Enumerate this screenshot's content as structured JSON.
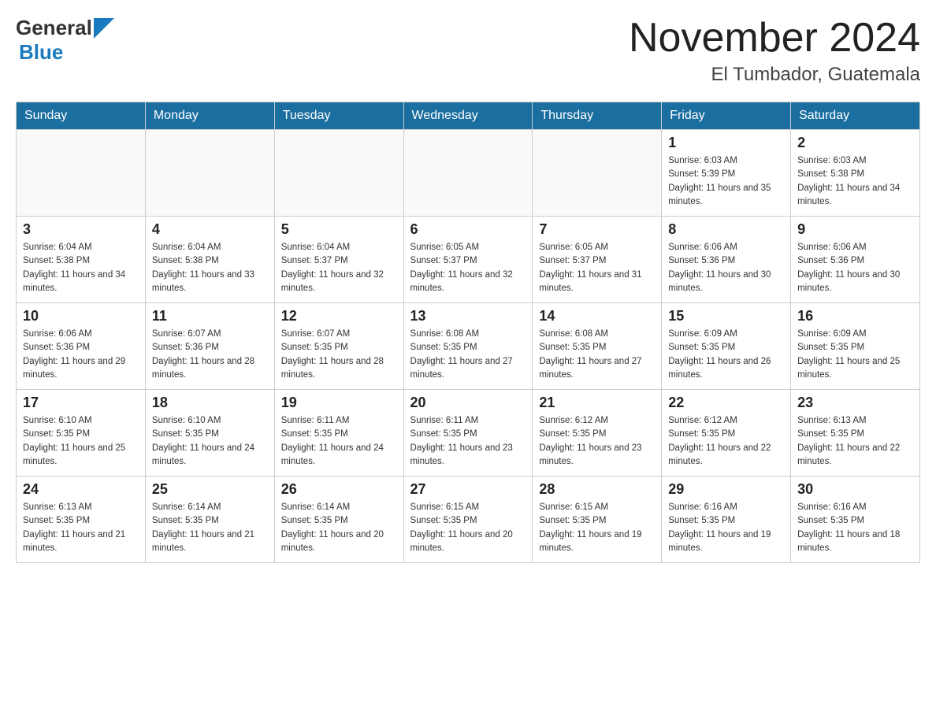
{
  "header": {
    "logo_text_general": "General",
    "logo_text_blue": "Blue",
    "month_title": "November 2024",
    "location": "El Tumbador, Guatemala"
  },
  "days_of_week": [
    "Sunday",
    "Monday",
    "Tuesday",
    "Wednesday",
    "Thursday",
    "Friday",
    "Saturday"
  ],
  "weeks": [
    [
      {
        "day": "",
        "sunrise": "",
        "sunset": "",
        "daylight": ""
      },
      {
        "day": "",
        "sunrise": "",
        "sunset": "",
        "daylight": ""
      },
      {
        "day": "",
        "sunrise": "",
        "sunset": "",
        "daylight": ""
      },
      {
        "day": "",
        "sunrise": "",
        "sunset": "",
        "daylight": ""
      },
      {
        "day": "",
        "sunrise": "",
        "sunset": "",
        "daylight": ""
      },
      {
        "day": "1",
        "sunrise": "Sunrise: 6:03 AM",
        "sunset": "Sunset: 5:39 PM",
        "daylight": "Daylight: 11 hours and 35 minutes."
      },
      {
        "day": "2",
        "sunrise": "Sunrise: 6:03 AM",
        "sunset": "Sunset: 5:38 PM",
        "daylight": "Daylight: 11 hours and 34 minutes."
      }
    ],
    [
      {
        "day": "3",
        "sunrise": "Sunrise: 6:04 AM",
        "sunset": "Sunset: 5:38 PM",
        "daylight": "Daylight: 11 hours and 34 minutes."
      },
      {
        "day": "4",
        "sunrise": "Sunrise: 6:04 AM",
        "sunset": "Sunset: 5:38 PM",
        "daylight": "Daylight: 11 hours and 33 minutes."
      },
      {
        "day": "5",
        "sunrise": "Sunrise: 6:04 AM",
        "sunset": "Sunset: 5:37 PM",
        "daylight": "Daylight: 11 hours and 32 minutes."
      },
      {
        "day": "6",
        "sunrise": "Sunrise: 6:05 AM",
        "sunset": "Sunset: 5:37 PM",
        "daylight": "Daylight: 11 hours and 32 minutes."
      },
      {
        "day": "7",
        "sunrise": "Sunrise: 6:05 AM",
        "sunset": "Sunset: 5:37 PM",
        "daylight": "Daylight: 11 hours and 31 minutes."
      },
      {
        "day": "8",
        "sunrise": "Sunrise: 6:06 AM",
        "sunset": "Sunset: 5:36 PM",
        "daylight": "Daylight: 11 hours and 30 minutes."
      },
      {
        "day": "9",
        "sunrise": "Sunrise: 6:06 AM",
        "sunset": "Sunset: 5:36 PM",
        "daylight": "Daylight: 11 hours and 30 minutes."
      }
    ],
    [
      {
        "day": "10",
        "sunrise": "Sunrise: 6:06 AM",
        "sunset": "Sunset: 5:36 PM",
        "daylight": "Daylight: 11 hours and 29 minutes."
      },
      {
        "day": "11",
        "sunrise": "Sunrise: 6:07 AM",
        "sunset": "Sunset: 5:36 PM",
        "daylight": "Daylight: 11 hours and 28 minutes."
      },
      {
        "day": "12",
        "sunrise": "Sunrise: 6:07 AM",
        "sunset": "Sunset: 5:35 PM",
        "daylight": "Daylight: 11 hours and 28 minutes."
      },
      {
        "day": "13",
        "sunrise": "Sunrise: 6:08 AM",
        "sunset": "Sunset: 5:35 PM",
        "daylight": "Daylight: 11 hours and 27 minutes."
      },
      {
        "day": "14",
        "sunrise": "Sunrise: 6:08 AM",
        "sunset": "Sunset: 5:35 PM",
        "daylight": "Daylight: 11 hours and 27 minutes."
      },
      {
        "day": "15",
        "sunrise": "Sunrise: 6:09 AM",
        "sunset": "Sunset: 5:35 PM",
        "daylight": "Daylight: 11 hours and 26 minutes."
      },
      {
        "day": "16",
        "sunrise": "Sunrise: 6:09 AM",
        "sunset": "Sunset: 5:35 PM",
        "daylight": "Daylight: 11 hours and 25 minutes."
      }
    ],
    [
      {
        "day": "17",
        "sunrise": "Sunrise: 6:10 AM",
        "sunset": "Sunset: 5:35 PM",
        "daylight": "Daylight: 11 hours and 25 minutes."
      },
      {
        "day": "18",
        "sunrise": "Sunrise: 6:10 AM",
        "sunset": "Sunset: 5:35 PM",
        "daylight": "Daylight: 11 hours and 24 minutes."
      },
      {
        "day": "19",
        "sunrise": "Sunrise: 6:11 AM",
        "sunset": "Sunset: 5:35 PM",
        "daylight": "Daylight: 11 hours and 24 minutes."
      },
      {
        "day": "20",
        "sunrise": "Sunrise: 6:11 AM",
        "sunset": "Sunset: 5:35 PM",
        "daylight": "Daylight: 11 hours and 23 minutes."
      },
      {
        "day": "21",
        "sunrise": "Sunrise: 6:12 AM",
        "sunset": "Sunset: 5:35 PM",
        "daylight": "Daylight: 11 hours and 23 minutes."
      },
      {
        "day": "22",
        "sunrise": "Sunrise: 6:12 AM",
        "sunset": "Sunset: 5:35 PM",
        "daylight": "Daylight: 11 hours and 22 minutes."
      },
      {
        "day": "23",
        "sunrise": "Sunrise: 6:13 AM",
        "sunset": "Sunset: 5:35 PM",
        "daylight": "Daylight: 11 hours and 22 minutes."
      }
    ],
    [
      {
        "day": "24",
        "sunrise": "Sunrise: 6:13 AM",
        "sunset": "Sunset: 5:35 PM",
        "daylight": "Daylight: 11 hours and 21 minutes."
      },
      {
        "day": "25",
        "sunrise": "Sunrise: 6:14 AM",
        "sunset": "Sunset: 5:35 PM",
        "daylight": "Daylight: 11 hours and 21 minutes."
      },
      {
        "day": "26",
        "sunrise": "Sunrise: 6:14 AM",
        "sunset": "Sunset: 5:35 PM",
        "daylight": "Daylight: 11 hours and 20 minutes."
      },
      {
        "day": "27",
        "sunrise": "Sunrise: 6:15 AM",
        "sunset": "Sunset: 5:35 PM",
        "daylight": "Daylight: 11 hours and 20 minutes."
      },
      {
        "day": "28",
        "sunrise": "Sunrise: 6:15 AM",
        "sunset": "Sunset: 5:35 PM",
        "daylight": "Daylight: 11 hours and 19 minutes."
      },
      {
        "day": "29",
        "sunrise": "Sunrise: 6:16 AM",
        "sunset": "Sunset: 5:35 PM",
        "daylight": "Daylight: 11 hours and 19 minutes."
      },
      {
        "day": "30",
        "sunrise": "Sunrise: 6:16 AM",
        "sunset": "Sunset: 5:35 PM",
        "daylight": "Daylight: 11 hours and 18 minutes."
      }
    ]
  ]
}
